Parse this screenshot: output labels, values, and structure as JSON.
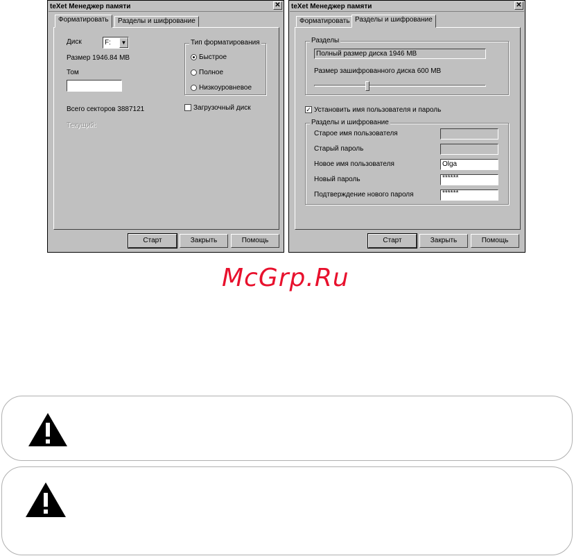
{
  "left_window": {
    "title": "teXet Менеджер памяти",
    "tabs": [
      "Форматировать",
      "Разделы и шифрование"
    ],
    "disk_label": "Диск",
    "disk_value": "F:",
    "size_text": "Размер 1946.84 MB",
    "volume_label": "Том",
    "volume_value": "",
    "format_group_title": "Тип форматирования",
    "format_options": [
      "Быстрое",
      "Полное",
      "Низкоуровневое"
    ],
    "selected_format": "Быстрое",
    "total_sectors_text": "Всего секторов 3887121",
    "boot_disk_label": "Загрузочный диск",
    "boot_disk_checked": false,
    "current_text": "Текущий:",
    "buttons": [
      "Старт",
      "Закрыть",
      "Помощь"
    ]
  },
  "right_window": {
    "title": "teXet Менеджер памяти",
    "tabs": [
      "Форматировать",
      "Разделы и шифрование"
    ],
    "partitions_group_title": "Разделы",
    "full_size_text": "Полный размер диска 1946 MB",
    "encrypted_size_text": "Размер зашифрованного диска 600 MB",
    "encrypted_fraction": 0.31,
    "set_credentials_label": "Установить имя пользователя и пароль",
    "set_credentials_checked": true,
    "encryption_group_title": "Разделы и шифрование",
    "fields": [
      {
        "label": "Старое имя пользователя",
        "value": "",
        "readonly": true
      },
      {
        "label": "Старый пароль",
        "value": "",
        "readonly": true
      },
      {
        "label": "Новое имя пользователя",
        "value": "Olga",
        "readonly": false
      },
      {
        "label": "Новый пароль",
        "value": "******",
        "readonly": false
      },
      {
        "label": "Подтверждение нового пароля",
        "value": "******",
        "readonly": false
      }
    ],
    "buttons": [
      "Старт",
      "Закрыть",
      "Помощь"
    ]
  },
  "watermark": "McGrp.Ru",
  "colors": {
    "watermark": "#e8112d",
    "window_bg": "#c0c0c0"
  },
  "warning_icons": [
    "warning-icon",
    "warning-icon"
  ]
}
